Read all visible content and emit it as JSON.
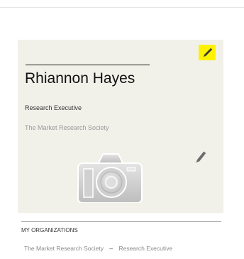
{
  "card": {
    "name": "Rhiannon Hayes",
    "job_title": "Research Executive",
    "organization": "The Market Research Society",
    "highlight_color": "#fff200",
    "edit_icon": "pencil-icon",
    "photo_icon": "camera-icon"
  },
  "organizations": {
    "heading": "MY ORGANIZATIONS",
    "items": [
      {
        "organization": "The Market Research Society",
        "separator": "–",
        "role": "Research Executive"
      }
    ]
  }
}
